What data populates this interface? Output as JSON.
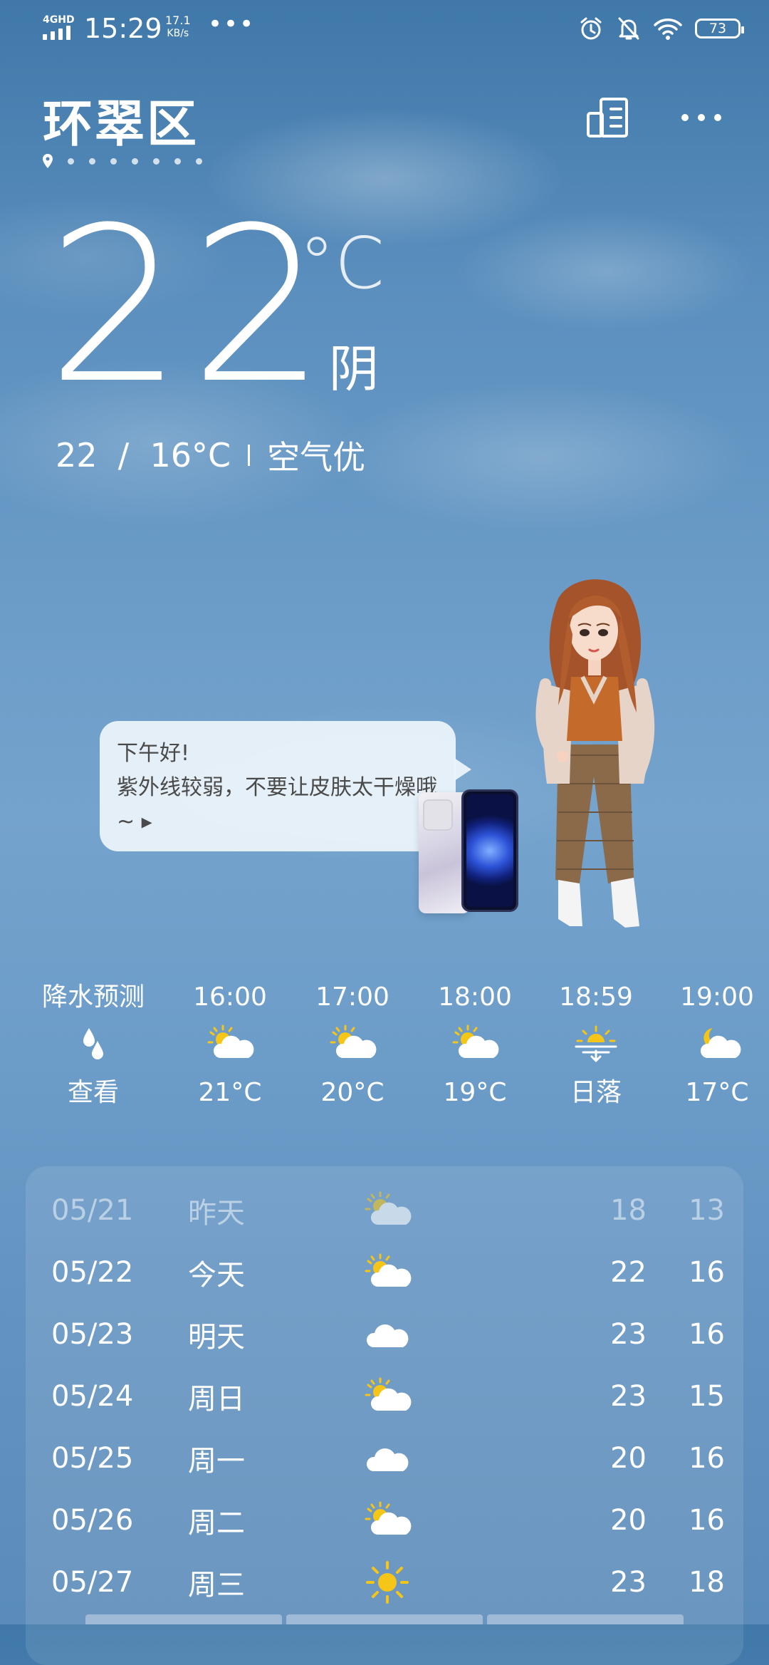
{
  "status_bar": {
    "network": "4GHD",
    "time": "15:29",
    "speed_value": "17.1",
    "speed_unit": "KB/s",
    "more": "•••",
    "battery": "73"
  },
  "header": {
    "city": "环翠区",
    "pages_count": 7
  },
  "current": {
    "temperature": "22",
    "unit": "°C",
    "condition": "阴",
    "range": "22  /  16°C",
    "air_quality": "空气优"
  },
  "assistant": {
    "greeting": "下午好!",
    "message": "紫外线较弱，不要让皮肤太干燥哦~ ▸"
  },
  "hourly": [
    {
      "time": "降水预测",
      "icon": "raindrop-icon",
      "value": "查看"
    },
    {
      "time": "16:00",
      "icon": "partly-cloudy-icon",
      "value": "21°C"
    },
    {
      "time": "17:00",
      "icon": "partly-cloudy-icon",
      "value": "20°C"
    },
    {
      "time": "18:00",
      "icon": "partly-cloudy-icon",
      "value": "19°C"
    },
    {
      "time": "18:59",
      "icon": "sunset-icon",
      "value": "日落"
    },
    {
      "time": "19:00",
      "icon": "partly-cloudy-night-icon",
      "value": "17°C"
    }
  ],
  "daily": [
    {
      "date": "05/21",
      "day": "昨天",
      "icon": "partly-cloudy-icon",
      "high": "18",
      "low": "13",
      "past": true
    },
    {
      "date": "05/22",
      "day": "今天",
      "icon": "partly-cloudy-icon",
      "high": "22",
      "low": "16",
      "past": false
    },
    {
      "date": "05/23",
      "day": "明天",
      "icon": "cloudy-icon",
      "high": "23",
      "low": "16",
      "past": false
    },
    {
      "date": "05/24",
      "day": "周日",
      "icon": "partly-cloudy-icon",
      "high": "23",
      "low": "15",
      "past": false
    },
    {
      "date": "05/25",
      "day": "周一",
      "icon": "cloudy-icon",
      "high": "20",
      "low": "16",
      "past": false
    },
    {
      "date": "05/26",
      "day": "周二",
      "icon": "partly-cloudy-icon",
      "high": "20",
      "low": "16",
      "past": false
    },
    {
      "date": "05/27",
      "day": "周三",
      "icon": "sunny-icon",
      "high": "23",
      "low": "18",
      "past": false
    }
  ],
  "colors": {
    "sun": "#f5c518",
    "cloud": "#ffffff",
    "sky_top": "#3f78a9",
    "sky_mid": "#74a3cd"
  }
}
